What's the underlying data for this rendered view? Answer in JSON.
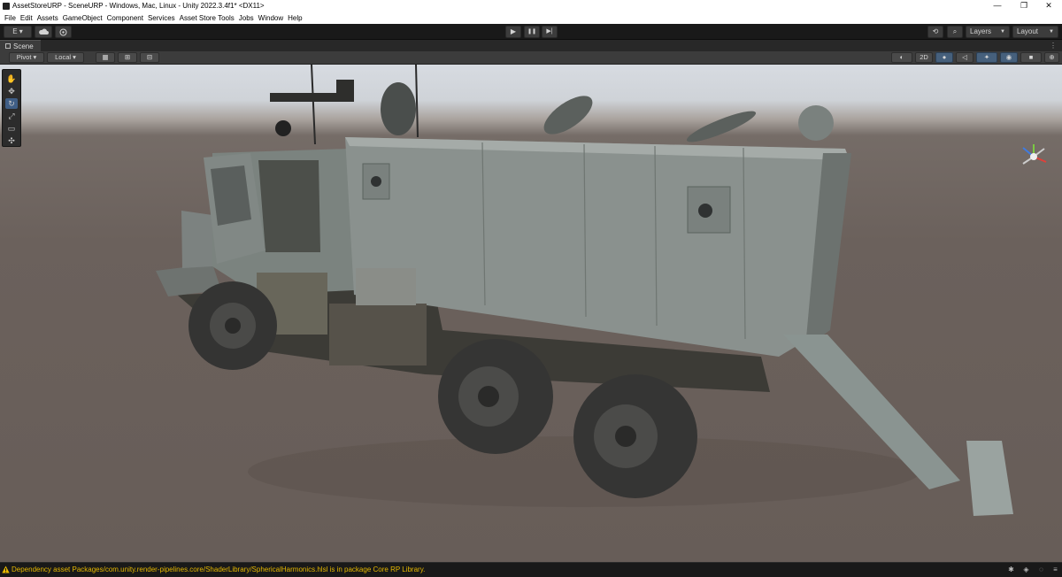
{
  "window": {
    "title": "AssetStoreURP - SceneURP - Windows, Mac, Linux - Unity 2022.3.4f1* <DX11>",
    "minimize_glyph": "—",
    "restore_glyph": "❐",
    "close_glyph": "✕"
  },
  "menu": [
    "File",
    "Edit",
    "Assets",
    "GameObject",
    "Component",
    "Services",
    "Asset Store Tools",
    "Jobs",
    "Window",
    "Help"
  ],
  "toolbar": {
    "account_label": "E ▾",
    "play_glyph": "▶",
    "pause_glyph": "❚❚",
    "step_glyph": "▶|",
    "history_glyph": "⟲",
    "search_glyph": "⌕",
    "layers_label": "Layers",
    "layout_label": "Layout"
  },
  "tab": {
    "label": "Scene",
    "menu_glyph": "⋮"
  },
  "scene_toolbar": {
    "pivot_label": "Pivot ▾",
    "local_label": "Local ▾",
    "view_2d_label": "2D"
  },
  "tools": [
    "hand-tool",
    "move-tool",
    "rotate-tool",
    "scale-tool",
    "rect-tool",
    "transform-tool"
  ],
  "status": {
    "message": "Dependency asset Packages/com.unity.render-pipelines.core/ShaderLibrary/SphericalHarmonics.hlsl is in package Core RP Library.",
    "color": "#e6b800"
  },
  "colors": {
    "accent": "#3f5e86",
    "editor_bg": "#191919",
    "panel_bg": "#3c3c3c"
  }
}
